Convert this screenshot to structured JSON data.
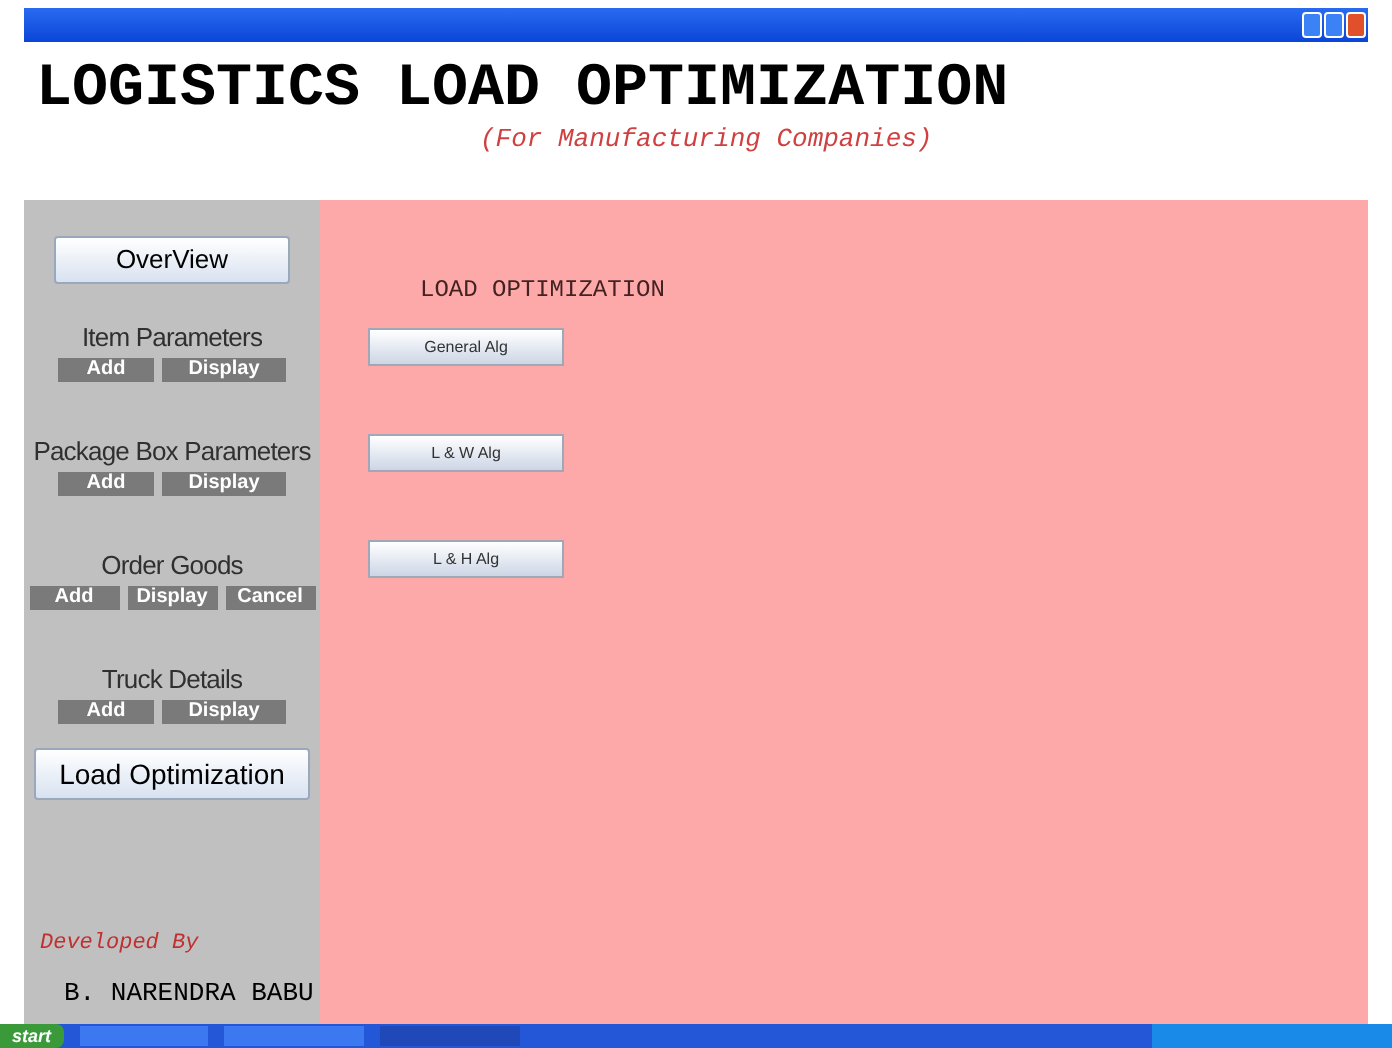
{
  "header": {
    "title": "LOGISTICS LOAD OPTIMIZATION",
    "subtitle": "(For Manufacturing Companies)"
  },
  "sidebar": {
    "overview_button": "OverView",
    "sections": [
      {
        "title": "Item Parameters",
        "buttons": [
          "Add",
          "Display"
        ]
      },
      {
        "title": "Package Box Parameters",
        "buttons": [
          "Add",
          "Display"
        ]
      },
      {
        "title": "Order Goods",
        "buttons": [
          "Add",
          "Display",
          "Cancel"
        ]
      },
      {
        "title": "Truck Details",
        "buttons": [
          "Add",
          "Display"
        ]
      }
    ],
    "load_button": "Load Optimization",
    "credit_label": "Developed By",
    "credit_name": "B. NARENDRA BABU"
  },
  "main": {
    "heading": "LOAD OPTIMIZATION",
    "buttons": [
      "General Alg",
      "L & W Alg",
      "L & H Alg"
    ]
  },
  "taskbar": {
    "start": "start"
  }
}
